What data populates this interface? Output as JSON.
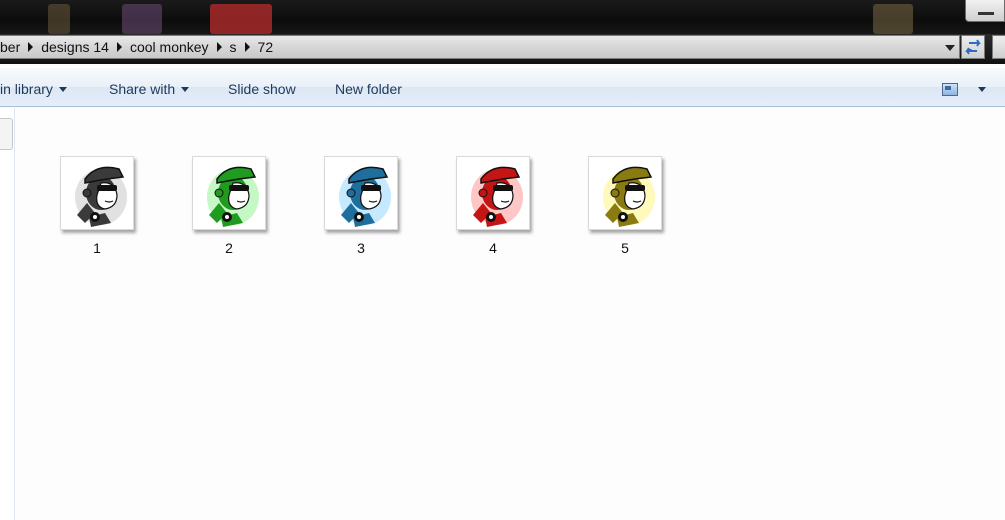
{
  "breadcrumb": [
    {
      "label": "ber"
    },
    {
      "label": "designs 14"
    },
    {
      "label": "cool monkey"
    },
    {
      "label": "s"
    },
    {
      "label": "72"
    }
  ],
  "commands": {
    "include_library": "in library",
    "share_with": "Share with",
    "slide_show": "Slide show",
    "new_folder": "New folder"
  },
  "files": [
    {
      "name": "1",
      "icon": "cool-monkey-gray-icon",
      "color": "#3a3a3a",
      "glow": "#bdbdbd"
    },
    {
      "name": "2",
      "icon": "cool-monkey-green-icon",
      "color": "#1f9b1f",
      "glow": "#7df07d"
    },
    {
      "name": "3",
      "icon": "cool-monkey-blue-icon",
      "color": "#1f6f9e",
      "glow": "#7fd0ff"
    },
    {
      "name": "4",
      "icon": "cool-monkey-red-icon",
      "color": "#c41414",
      "glow": "#ff8080"
    },
    {
      "name": "5",
      "icon": "cool-monkey-yellow-icon",
      "color": "#8a7a12",
      "glow": "#fff36a"
    }
  ]
}
